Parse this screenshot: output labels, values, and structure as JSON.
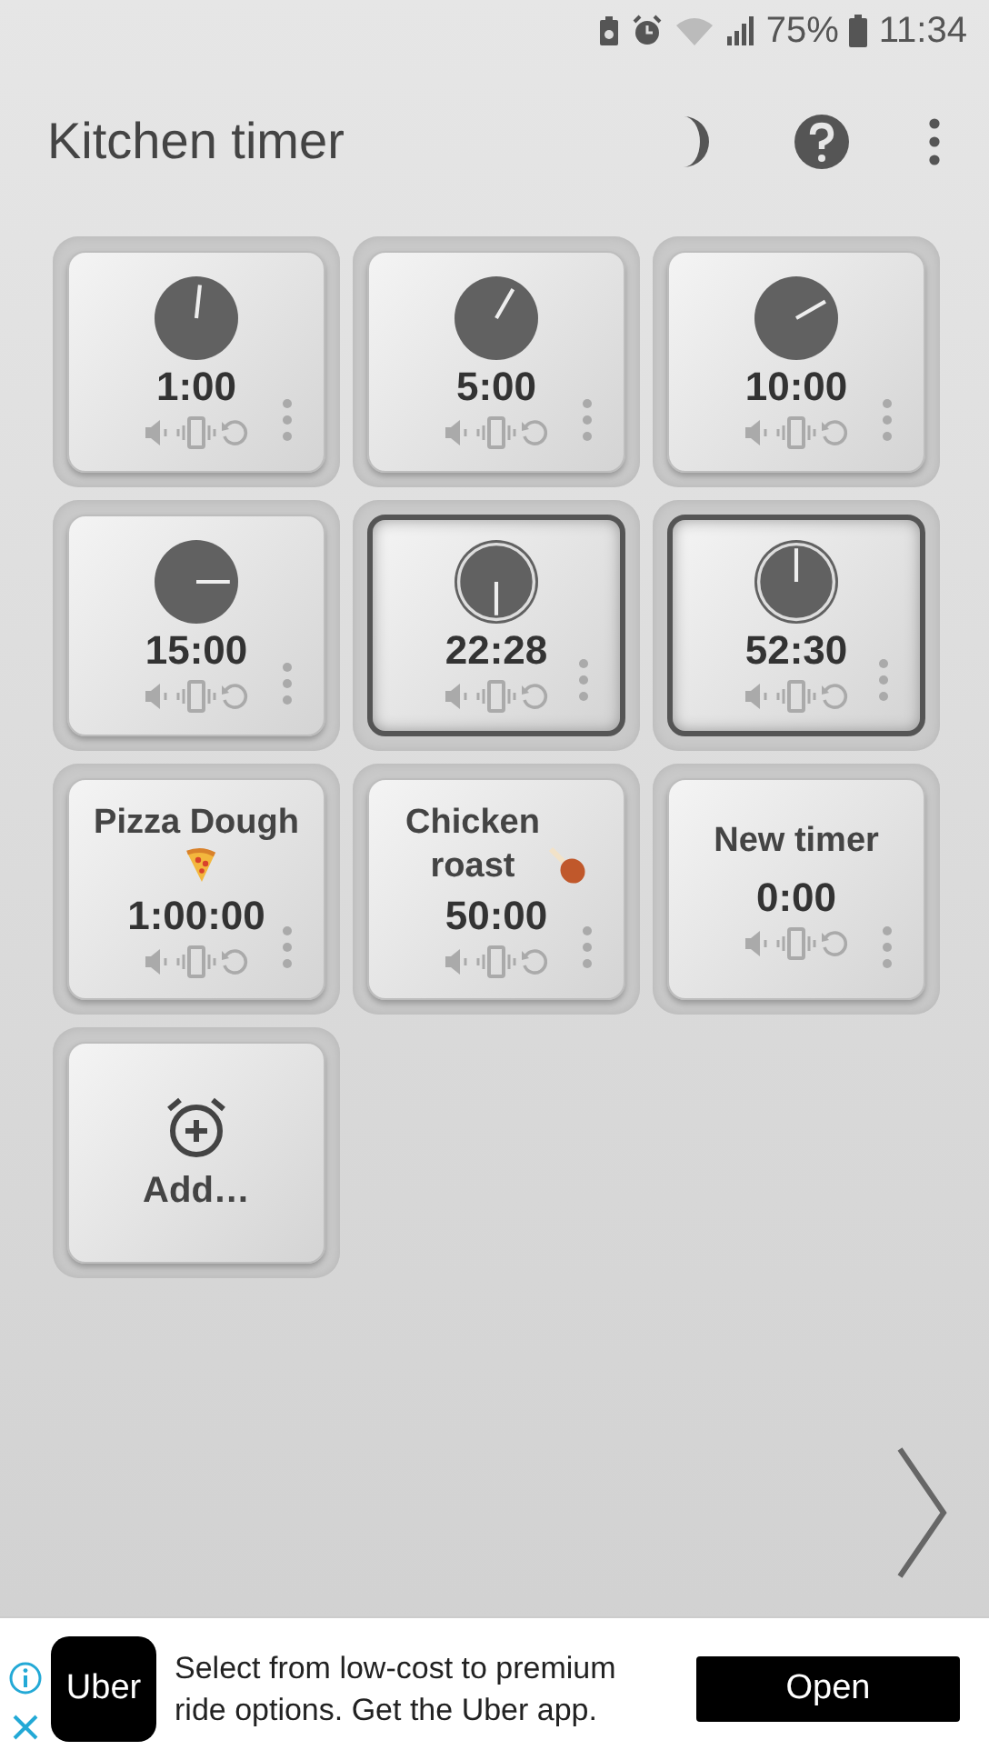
{
  "status_bar": {
    "battery": "75%",
    "time": "11:34"
  },
  "app_bar": {
    "title": "Kitchen timer"
  },
  "timers": [
    {
      "kind": "dial",
      "time": "1:00",
      "running": false
    },
    {
      "kind": "dial",
      "time": "5:00",
      "running": false
    },
    {
      "kind": "dial",
      "time": "10:00",
      "running": false
    },
    {
      "kind": "dial",
      "time": "15:00",
      "running": false
    },
    {
      "kind": "dial",
      "time": "22:28",
      "running": true
    },
    {
      "kind": "dial",
      "time": "52:30",
      "running": true
    },
    {
      "kind": "named",
      "name": "Pizza Dough",
      "time": "1:00:00",
      "running": false
    },
    {
      "kind": "named",
      "name": "Chicken roast",
      "time": "50:00",
      "running": false
    },
    {
      "kind": "new",
      "name": "New timer",
      "time": "0:00",
      "running": false
    }
  ],
  "add_button": {
    "label": "Add…"
  },
  "ad": {
    "logo": "Uber",
    "text": "Select from low-cost to premium ride options. Get the Uber app.",
    "button": "Open"
  }
}
